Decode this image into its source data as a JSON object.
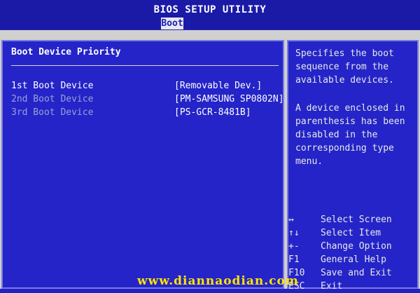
{
  "window": {
    "title": "BIOS SETUP UTILITY"
  },
  "tabs": [
    {
      "label": "Boot",
      "active": true
    }
  ],
  "boot_panel": {
    "section_title": "Boot Device Priority",
    "items": [
      {
        "label": "1st Boot Device",
        "value": "[Removable Dev.]"
      },
      {
        "label": "2nd Boot Device",
        "value": "[PM-SAMSUNG SP0802N]"
      },
      {
        "label": "3rd Boot Device",
        "value": "[PS-GCR-8481B]"
      }
    ]
  },
  "help_panel": {
    "description": "Specifies the boot sequence from the available devices.",
    "note": "A device enclosed in parenthesis has been disabled in the corresponding type menu.",
    "keys": [
      {
        "key": "↔",
        "action": "Select Screen"
      },
      {
        "key": "↑↓",
        "action": "Select Item"
      },
      {
        "key": "+-",
        "action": "Change Option"
      },
      {
        "key": "F1",
        "action": "General Help"
      },
      {
        "key": "F10",
        "action": "Save and Exit"
      },
      {
        "key": "ESC",
        "action": "Exit"
      }
    ]
  },
  "watermark": "www.diannaodian.com",
  "colors": {
    "background": "#2222c4",
    "panel_border": "#7a7ae0",
    "tab_active_bg": "#e8e8e8",
    "watermark": "#ffe400"
  }
}
